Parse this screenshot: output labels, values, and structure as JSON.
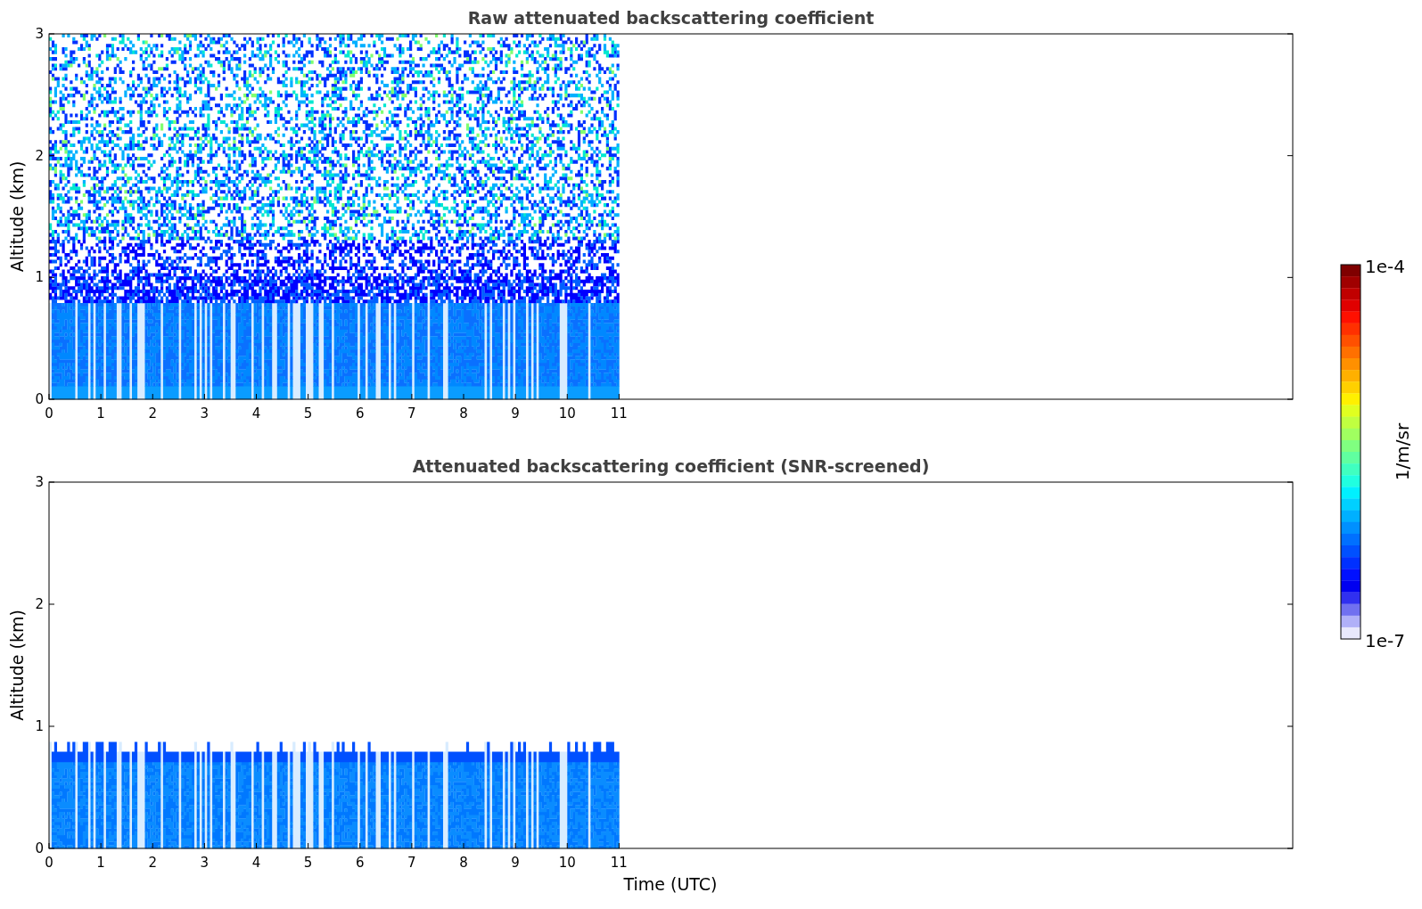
{
  "panels": [
    {
      "kind": "raw",
      "title": "Raw attenuated backscattering coefficient",
      "ylabel": "Altitude (km)",
      "yticks": [
        "3",
        "2",
        "1",
        "0"
      ],
      "xticks": [
        "0",
        "1",
        "2",
        "3",
        "4",
        "5",
        "6",
        "7",
        "8",
        "9",
        "10",
        "11"
      ]
    },
    {
      "kind": "screened",
      "title": "Attenuated backscattering coefficient (SNR-screened)",
      "ylabel": "Altitude (km)",
      "yticks": [
        "3",
        "2",
        "1",
        "0"
      ],
      "xticks": [
        "0",
        "1",
        "2",
        "3",
        "4",
        "5",
        "6",
        "7",
        "8",
        "9",
        "10",
        "11"
      ],
      "xlabel": "Time (UTC)"
    }
  ],
  "colorbar": {
    "max_label": "1e-4",
    "min_label": "1e-7",
    "unit": "1/m/sr"
  }
}
